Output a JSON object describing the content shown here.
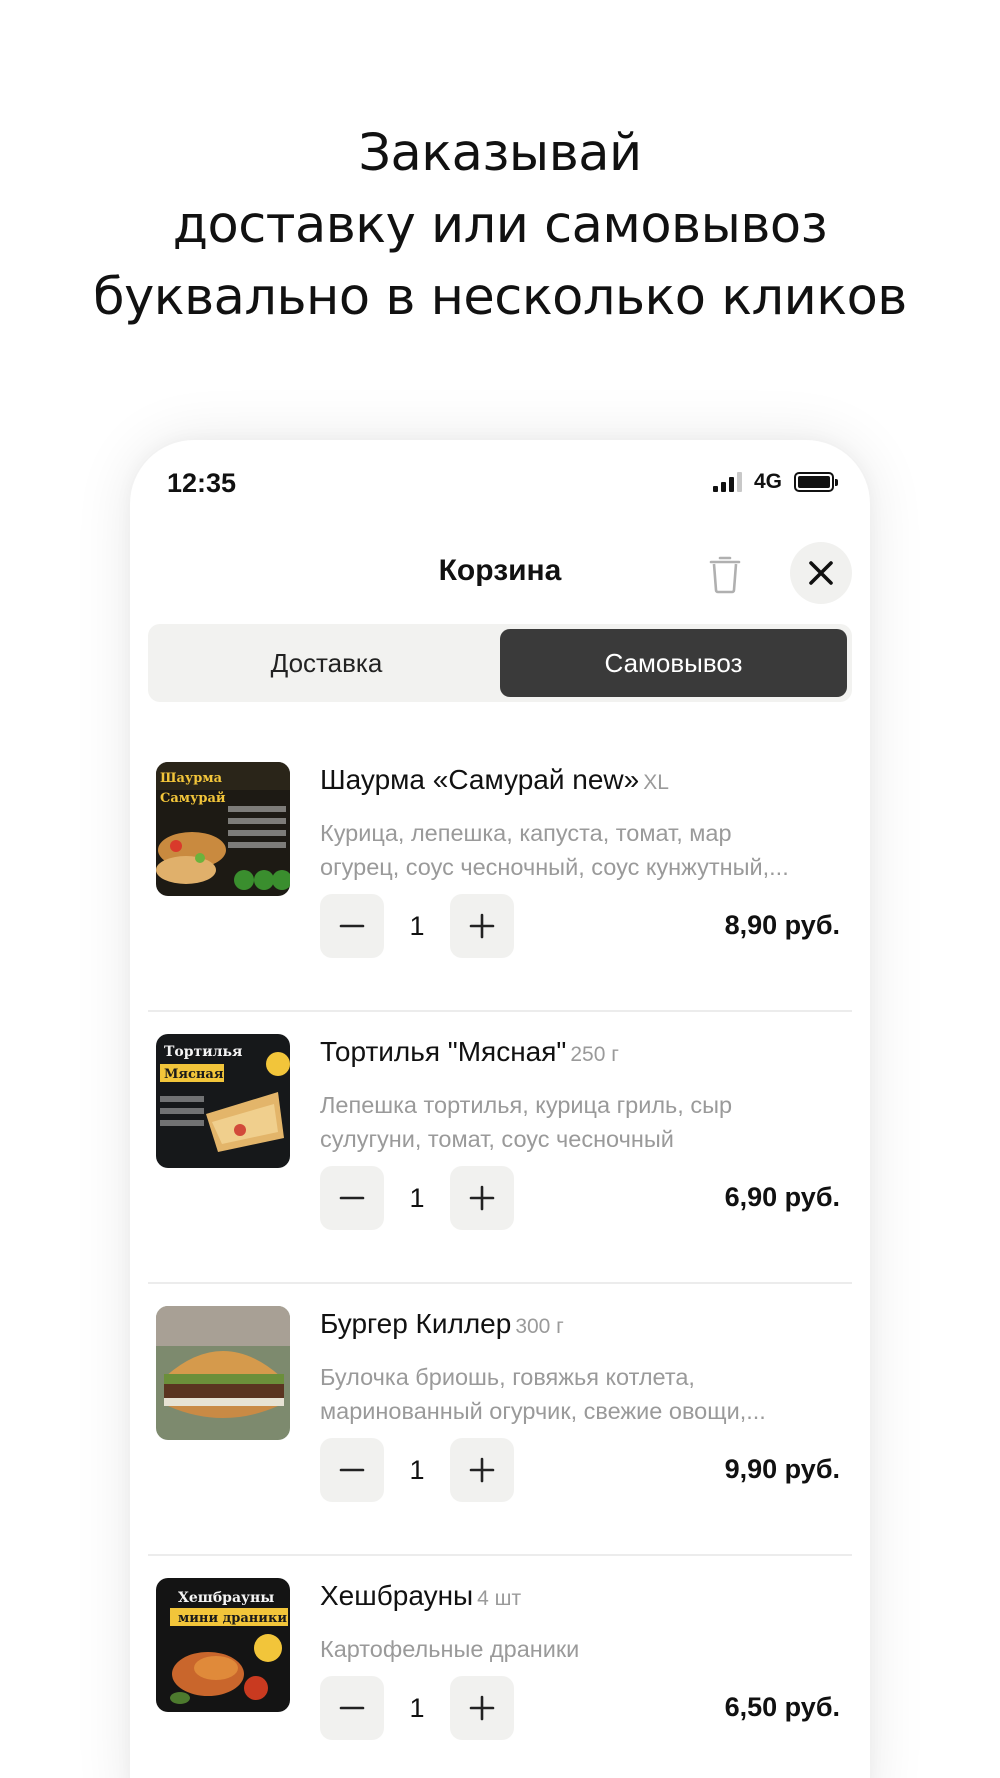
{
  "headline": {
    "line1": "Заказывай",
    "line2": "доставку или самовывоз",
    "line3": "буквально в несколько кликов"
  },
  "status_bar": {
    "time": "12:35",
    "network": "4G"
  },
  "header": {
    "title": "Корзина"
  },
  "tabs": [
    {
      "label": "Доставка",
      "active": false
    },
    {
      "label": "Самовывоз",
      "active": true
    }
  ],
  "cart_items": [
    {
      "name": "Шаурма «Самурай new»",
      "weight": "XL",
      "description_line1": "Курица, лепешка, капуста, томат, мар",
      "description_line2": "огурец, соус чесночный, соус кунжутный,...",
      "quantity": "1",
      "price": "8,90 руб.",
      "image_text": "Шаурма Самурай"
    },
    {
      "name": "Тортилья \"Мясная\"",
      "weight": "250 г",
      "description_line1": "Лепешка тортилья, курица гриль, сыр",
      "description_line2": "сулугуни, томат, соус чесночный",
      "quantity": "1",
      "price": "6,90 руб.",
      "image_text": "Тортилья Мясная"
    },
    {
      "name": "Бургер Киллер",
      "weight": "300 г",
      "description_line1": "Булочка бриошь, говяжья котлета,",
      "description_line2": "маринованный огурчик, свежие овощи,...",
      "quantity": "1",
      "price": "9,90 руб.",
      "image_text": ""
    },
    {
      "name": "Хешбрауны",
      "weight": "4 шт",
      "description_line1": "Картофельные драники",
      "description_line2": "",
      "quantity": "1",
      "price": "6,50 руб.",
      "image_text": "Хешбрауны мини драники"
    }
  ],
  "icons": {
    "trash": "trash-icon",
    "close": "close-icon",
    "minus": "minus-icon",
    "plus": "plus-icon"
  },
  "colors": {
    "active_tab": "#3a3a3a",
    "secondary_text": "#9a9a9a",
    "button_bg": "#f1f1ef"
  }
}
